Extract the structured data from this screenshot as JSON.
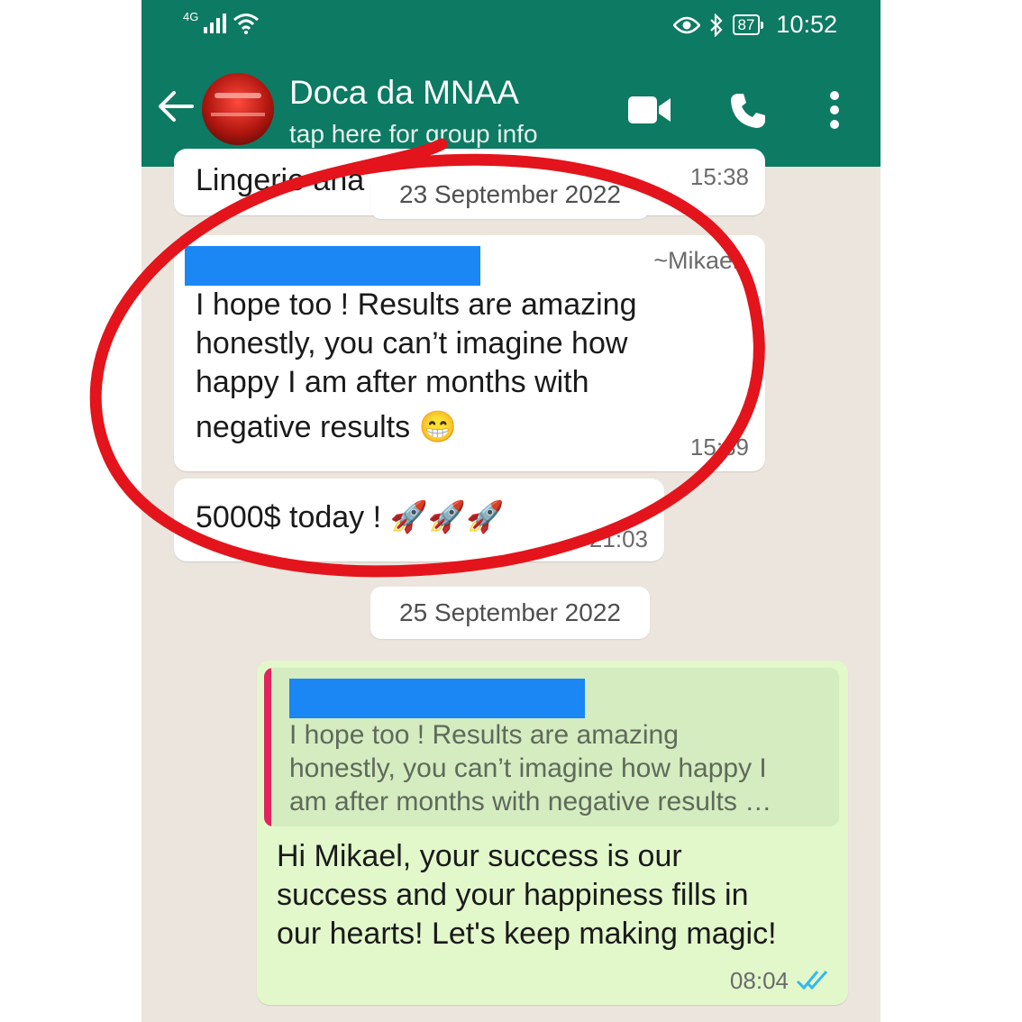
{
  "status_bar": {
    "network": "4G",
    "battery": "87",
    "time": "10:52"
  },
  "header": {
    "title": "Doca da MNAA",
    "subtitle": "tap here for group info",
    "icons": [
      "back-arrow-icon",
      "video-call-icon",
      "phone-icon",
      "more-options-icon"
    ]
  },
  "messages": [
    {
      "type": "incoming",
      "text": "Lingerie aha",
      "time": "15:38"
    },
    {
      "type": "date",
      "text": "23 September 2022"
    },
    {
      "type": "incoming",
      "sender": "~Mikael",
      "lines": [
        "I hope too ! Results are amazing",
        "honestly, you can’t imagine how",
        "happy I am after months with",
        "negative results 😁"
      ],
      "time": "15:39"
    },
    {
      "type": "incoming",
      "text": "5000$ today ! 🚀🚀🚀",
      "time": "21:03"
    },
    {
      "type": "date",
      "text": "25 September 2022"
    },
    {
      "type": "outgoing",
      "quote_lines": [
        "I hope too ! Results are amazing",
        "honestly, you can’t imagine how happy I",
        "am after months with negative results …"
      ],
      "lines": [
        "Hi Mikael, your success is our",
        "success and your happiness fills in",
        "our hearts! Let's keep making magic!"
      ],
      "time": "08:04",
      "status": "read"
    }
  ],
  "colors": {
    "header": "#0d7a63",
    "chat_background": "#ece5dd",
    "outgoing_bubble": "#e2f8cb",
    "quote_bar": "#e0245e",
    "redaction": "#1a87f5",
    "annotation_circle": "#e3141b",
    "read_ticks": "#34b7f1"
  }
}
